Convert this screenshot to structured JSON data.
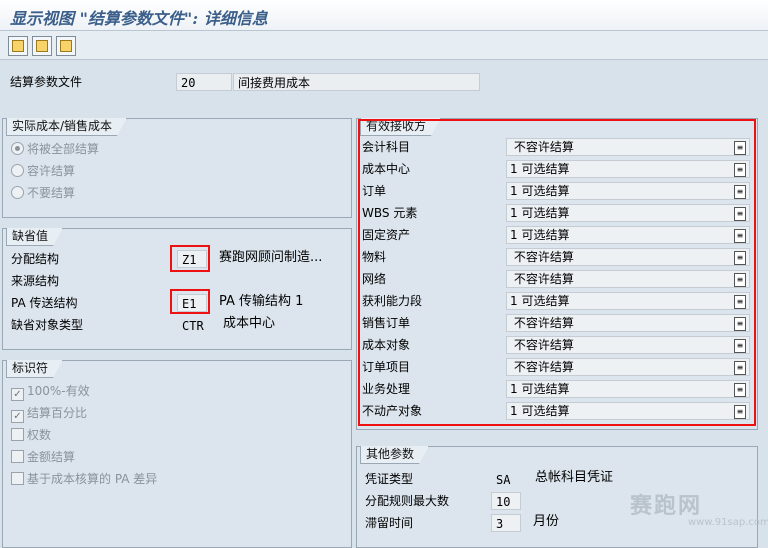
{
  "window": {
    "title": "显示视图 \"结算参数文件\": 详细信息"
  },
  "toolbar": {
    "buttons": [
      "prev-entry",
      "next-entry",
      "other-entry"
    ]
  },
  "header": {
    "label": "结算参数文件",
    "code": "20",
    "description": "间接费用成本"
  },
  "actual_cost": {
    "caption": "实际成本/销售成本",
    "options": [
      {
        "label": "将被全部结算",
        "selected": true
      },
      {
        "label": "容许结算",
        "selected": false
      },
      {
        "label": "不要结算",
        "selected": false
      }
    ]
  },
  "defaults": {
    "caption": "缺省值",
    "rows": [
      {
        "label": "分配结构",
        "value": "Z1",
        "text": "赛跑网顾问制造..."
      },
      {
        "label": "来源结构",
        "value": "",
        "text": ""
      },
      {
        "label": "PA 传送结构",
        "value": "E1",
        "text": "PA 传输结构 1"
      },
      {
        "label": "缺省对象类型",
        "value": "CTR",
        "text": "成本中心"
      }
    ]
  },
  "indicators": {
    "caption": "标识符",
    "items": [
      {
        "label": "100%-有效",
        "checked": true
      },
      {
        "label": "结算百分比",
        "checked": true
      },
      {
        "label": "权数",
        "checked": false
      },
      {
        "label": "金额结算",
        "checked": false
      },
      {
        "label": "基于成本核算的 PA 差异",
        "checked": false
      }
    ]
  },
  "receivers": {
    "caption": "有效接收方",
    "rows": [
      {
        "label": "会计科目",
        "value": " 不容许结算"
      },
      {
        "label": "成本中心",
        "value": "1 可选结算"
      },
      {
        "label": "订单",
        "value": "1 可选结算"
      },
      {
        "label": "WBS 元素",
        "value": "1 可选结算"
      },
      {
        "label": "固定资产",
        "value": "1 可选结算"
      },
      {
        "label": "物料",
        "value": " 不容许结算"
      },
      {
        "label": "网络",
        "value": " 不容许结算"
      },
      {
        "label": "获利能力段",
        "value": "1 可选结算"
      },
      {
        "label": "销售订单",
        "value": " 不容许结算"
      },
      {
        "label": "成本对象",
        "value": " 不容许结算"
      },
      {
        "label": "订单项目",
        "value": " 不容许结算"
      },
      {
        "label": "业务处理",
        "value": "1 可选结算"
      },
      {
        "label": "不动产对象",
        "value": "1 可选结算"
      }
    ]
  },
  "other": {
    "caption": "其他参数",
    "doc_type_label": "凭证类型",
    "doc_type": "SA",
    "doc_type_text": "总帐科目凭证",
    "max_rules_label": "分配规则最大数",
    "max_rules": "10",
    "retention_label": "滞留时间",
    "retention": "3",
    "retention_unit": "月份"
  },
  "watermark": {
    "brand": "赛跑网",
    "url": "www.91sap.com"
  },
  "colors": {
    "highlight": "#e11111",
    "title": "#3b5f8a"
  }
}
